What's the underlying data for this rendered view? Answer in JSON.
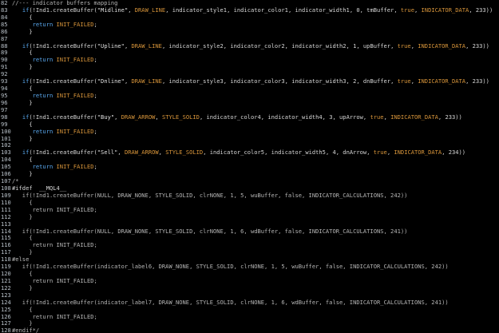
{
  "editor": {
    "theme": {
      "background": "#000000",
      "line_number": "#b8c0c8",
      "keyword": "#5aa9f0",
      "constant": "#d8953a",
      "plain": "#d6d6d6",
      "comment": "#b5b5b5"
    },
    "lines": [
      {
        "n": "82",
        "t": [
          [
            "tok-comment",
            "//--- indicator buffers mapping"
          ]
        ]
      },
      {
        "n": "83",
        "t": [
          [
            "tok-plain",
            "   "
          ],
          [
            "tok-kw",
            "if"
          ],
          [
            "tok-plain",
            "(!Ind1.createBuffer("
          ],
          [
            "tok-str",
            "\"Midline\""
          ],
          [
            "tok-plain",
            ", "
          ],
          [
            "tok-const",
            "DRAW_LINE"
          ],
          [
            "tok-plain",
            ", indicator_style1, indicator_color1, indicator_width1, 0, tmBuffer, "
          ],
          [
            "tok-bool",
            "true"
          ],
          [
            "tok-plain",
            ", "
          ],
          [
            "tok-const",
            "INDICATOR_DATA"
          ],
          [
            "tok-plain",
            ", 233))"
          ]
        ]
      },
      {
        "n": "84",
        "t": [
          [
            "tok-plain",
            "     {"
          ]
        ]
      },
      {
        "n": "85",
        "t": [
          [
            "tok-plain",
            "      "
          ],
          [
            "tok-kw",
            "return"
          ],
          [
            "tok-plain",
            " "
          ],
          [
            "tok-const",
            "INIT_FAILED"
          ],
          [
            "tok-plain",
            ";"
          ]
        ]
      },
      {
        "n": "86",
        "t": [
          [
            "tok-plain",
            "     }"
          ]
        ]
      },
      {
        "n": "87",
        "t": [
          [
            "tok-plain",
            ""
          ]
        ]
      },
      {
        "n": "88",
        "t": [
          [
            "tok-plain",
            "   "
          ],
          [
            "tok-kw",
            "if"
          ],
          [
            "tok-plain",
            "(!Ind1.createBuffer("
          ],
          [
            "tok-str",
            "\"Upline\""
          ],
          [
            "tok-plain",
            ", "
          ],
          [
            "tok-const",
            "DRAW_LINE"
          ],
          [
            "tok-plain",
            ", indicator_style2, indicator_color2, indicator_width2, 1, upBuffer, "
          ],
          [
            "tok-bool",
            "true"
          ],
          [
            "tok-plain",
            ", "
          ],
          [
            "tok-const",
            "INDICATOR_DATA"
          ],
          [
            "tok-plain",
            ", 233))"
          ]
        ]
      },
      {
        "n": "89",
        "t": [
          [
            "tok-plain",
            "     {"
          ]
        ]
      },
      {
        "n": "90",
        "t": [
          [
            "tok-plain",
            "      "
          ],
          [
            "tok-kw",
            "return"
          ],
          [
            "tok-plain",
            " "
          ],
          [
            "tok-const",
            "INIT_FAILED"
          ],
          [
            "tok-plain",
            ";"
          ]
        ]
      },
      {
        "n": "91",
        "t": [
          [
            "tok-plain",
            "     }"
          ]
        ]
      },
      {
        "n": "92",
        "t": [
          [
            "tok-plain",
            ""
          ]
        ]
      },
      {
        "n": "93",
        "t": [
          [
            "tok-plain",
            "   "
          ],
          [
            "tok-kw",
            "if"
          ],
          [
            "tok-plain",
            "(!Ind1.createBuffer("
          ],
          [
            "tok-str",
            "\"Dnline\""
          ],
          [
            "tok-plain",
            ", "
          ],
          [
            "tok-const",
            "DRAW_LINE"
          ],
          [
            "tok-plain",
            ", indicator_style3, indicator_color3, indicator_width3, 2, dnBuffer, "
          ],
          [
            "tok-bool",
            "true"
          ],
          [
            "tok-plain",
            ", "
          ],
          [
            "tok-const",
            "INDICATOR_DATA"
          ],
          [
            "tok-plain",
            ", 233))"
          ]
        ]
      },
      {
        "n": "94",
        "t": [
          [
            "tok-plain",
            "     {"
          ]
        ]
      },
      {
        "n": "95",
        "t": [
          [
            "tok-plain",
            "      "
          ],
          [
            "tok-kw",
            "return"
          ],
          [
            "tok-plain",
            " "
          ],
          [
            "tok-const",
            "INIT_FAILED"
          ],
          [
            "tok-plain",
            ";"
          ]
        ]
      },
      {
        "n": "96",
        "t": [
          [
            "tok-plain",
            "     }"
          ]
        ]
      },
      {
        "n": "97",
        "t": [
          [
            "tok-plain",
            ""
          ]
        ]
      },
      {
        "n": "98",
        "t": [
          [
            "tok-plain",
            "   "
          ],
          [
            "tok-kw",
            "if"
          ],
          [
            "tok-plain",
            "(!Ind1.createBuffer("
          ],
          [
            "tok-str",
            "\"Buy\""
          ],
          [
            "tok-plain",
            ", "
          ],
          [
            "tok-const",
            "DRAW_ARROW"
          ],
          [
            "tok-plain",
            ", "
          ],
          [
            "tok-const",
            "STYLE_SOLID"
          ],
          [
            "tok-plain",
            ", indicator_color4, indicator_width4, 3, upArrow, "
          ],
          [
            "tok-bool",
            "true"
          ],
          [
            "tok-plain",
            ", "
          ],
          [
            "tok-const",
            "INDICATOR_DATA"
          ],
          [
            "tok-plain",
            ", 233))"
          ]
        ]
      },
      {
        "n": "99",
        "t": [
          [
            "tok-plain",
            "     {"
          ]
        ]
      },
      {
        "n": "100",
        "t": [
          [
            "tok-plain",
            "      "
          ],
          [
            "tok-kw",
            "return"
          ],
          [
            "tok-plain",
            " "
          ],
          [
            "tok-const",
            "INIT_FAILED"
          ],
          [
            "tok-plain",
            ";"
          ]
        ]
      },
      {
        "n": "101",
        "t": [
          [
            "tok-plain",
            "     }"
          ]
        ]
      },
      {
        "n": "102",
        "t": [
          [
            "tok-plain",
            ""
          ]
        ]
      },
      {
        "n": "103",
        "t": [
          [
            "tok-plain",
            "   "
          ],
          [
            "tok-kw",
            "if"
          ],
          [
            "tok-plain",
            "(!Ind1.createBuffer("
          ],
          [
            "tok-str",
            "\"Sell\""
          ],
          [
            "tok-plain",
            ", "
          ],
          [
            "tok-const",
            "DRAW_ARROW"
          ],
          [
            "tok-plain",
            ", "
          ],
          [
            "tok-const",
            "STYLE_SOLID"
          ],
          [
            "tok-plain",
            ", indicator_color5, indicator_width5, 4, dnArrow, "
          ],
          [
            "tok-bool",
            "true"
          ],
          [
            "tok-plain",
            ", "
          ],
          [
            "tok-const",
            "INDICATOR_DATA"
          ],
          [
            "tok-plain",
            ", 234))"
          ]
        ]
      },
      {
        "n": "104",
        "t": [
          [
            "tok-plain",
            "     {"
          ]
        ]
      },
      {
        "n": "105",
        "t": [
          [
            "tok-plain",
            "      "
          ],
          [
            "tok-kw",
            "return"
          ],
          [
            "tok-plain",
            " "
          ],
          [
            "tok-const",
            "INIT_FAILED"
          ],
          [
            "tok-plain",
            ";"
          ]
        ]
      },
      {
        "n": "106",
        "t": [
          [
            "tok-plain",
            "     }"
          ]
        ]
      },
      {
        "n": "107",
        "t": [
          [
            "tok-comment",
            "/*"
          ]
        ]
      },
      {
        "n": "108",
        "t": [
          [
            "tok-pre",
            "#ifdef  __MQL4__"
          ]
        ]
      },
      {
        "n": "109",
        "t": [
          [
            "tok-comment",
            "   if(!Ind1.createBuffer(NULL, DRAW_NONE, STYLE_SOLID, clrNONE, 1, 5, wuBuffer, false, INDICATOR_CALCULATIONS, 242))"
          ]
        ]
      },
      {
        "n": "110",
        "t": [
          [
            "tok-comment",
            "     {"
          ]
        ]
      },
      {
        "n": "111",
        "t": [
          [
            "tok-comment",
            "      return INIT_FAILED;"
          ]
        ]
      },
      {
        "n": "112",
        "t": [
          [
            "tok-comment",
            "     }"
          ]
        ]
      },
      {
        "n": "113",
        "t": [
          [
            "tok-comment",
            ""
          ]
        ]
      },
      {
        "n": "114",
        "t": [
          [
            "tok-comment",
            "   if(!Ind1.createBuffer(NULL, DRAW_NONE, STYLE_SOLID, clrNONE, 1, 6, wdBuffer, false, INDICATOR_CALCULATIONS, 241))"
          ]
        ]
      },
      {
        "n": "115",
        "t": [
          [
            "tok-comment",
            "     {"
          ]
        ]
      },
      {
        "n": "116",
        "t": [
          [
            "tok-comment",
            "      return INIT_FAILED;"
          ]
        ]
      },
      {
        "n": "117",
        "t": [
          [
            "tok-comment",
            "     }"
          ]
        ]
      },
      {
        "n": "118",
        "t": [
          [
            "tok-comment",
            "#else"
          ]
        ]
      },
      {
        "n": "119",
        "t": [
          [
            "tok-comment",
            "   if(!Ind1.createBuffer(indicator_label6, DRAW_NONE, STYLE_SOLID, clrNONE, 1, 5, wuBuffer, false, INDICATOR_CALCULATIONS, 242))"
          ]
        ]
      },
      {
        "n": "120",
        "t": [
          [
            "tok-comment",
            "     {"
          ]
        ]
      },
      {
        "n": "121",
        "t": [
          [
            "tok-comment",
            "      return INIT_FAILED;"
          ]
        ]
      },
      {
        "n": "122",
        "t": [
          [
            "tok-comment",
            "     }"
          ]
        ]
      },
      {
        "n": "123",
        "t": [
          [
            "tok-comment",
            ""
          ]
        ]
      },
      {
        "n": "124",
        "t": [
          [
            "tok-comment",
            "   if(!Ind1.createBuffer(indicator_label7, DRAW_NONE, STYLE_SOLID, clrNONE, 1, 6, wdBuffer, false, INDICATOR_CALCULATIONS, 241))"
          ]
        ]
      },
      {
        "n": "125",
        "t": [
          [
            "tok-comment",
            "     {"
          ]
        ]
      },
      {
        "n": "126",
        "t": [
          [
            "tok-comment",
            "      return INIT_FAILED;"
          ]
        ]
      },
      {
        "n": "127",
        "t": [
          [
            "tok-comment",
            "     }"
          ]
        ]
      },
      {
        "n": "128",
        "t": [
          [
            "tok-comment",
            "#endif*/"
          ]
        ]
      }
    ]
  }
}
